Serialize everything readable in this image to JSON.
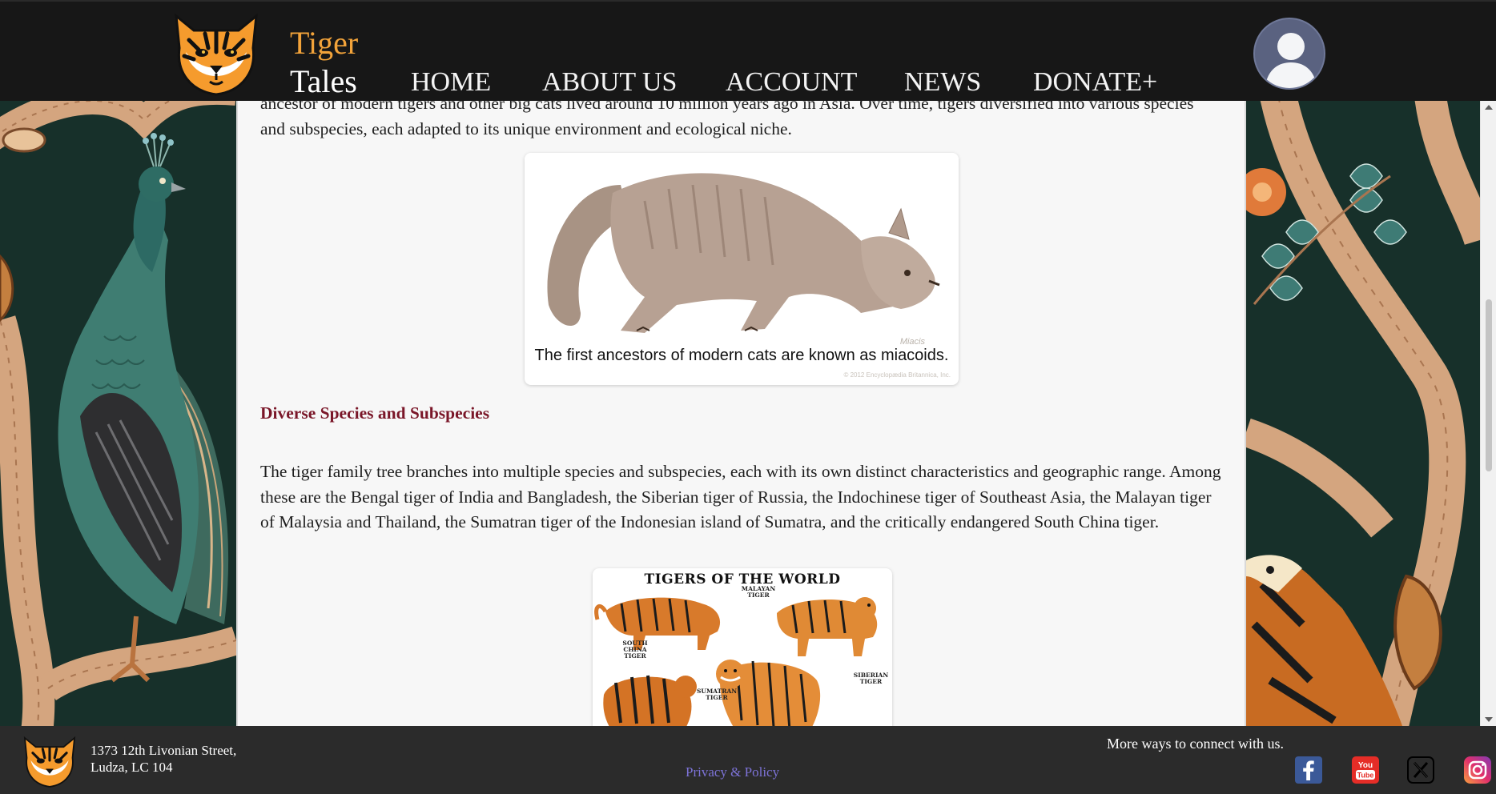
{
  "header": {
    "brand_top": "Tiger",
    "brand_bottom": "Tales",
    "nav": [
      "HOME",
      "ABOUT US",
      "ACCOUNT",
      "NEWS",
      "DONATE+"
    ]
  },
  "article": {
    "intro_tail": "ancestor of modern tigers and other big cats lived around 10 million years ago in Asia. Over time, tigers diversified into various species and subspecies, each adapted to its unique environment and ecological niche.",
    "figure1": {
      "caption": "The first ancestors of modern cats are known as miacoids.",
      "label": "Miacis",
      "copyright": "© 2012 Encyclopædia Britannica, Inc."
    },
    "section_heading": "Diverse Species and Subspecies",
    "species_paragraph": "The tiger family tree branches into multiple species and subspecies, each with its own distinct characteristics and geographic range. Among these are the Bengal tiger of India and Bangladesh, the Siberian tiger of Russia, the Indochinese tiger of Southeast Asia, the Malayan tiger of Malaysia and Thailand, the Sumatran tiger of the Indonesian island of Sumatra, and the critically endangered South China tiger.",
    "figure2": {
      "title": "TIGERS OF THE WORLD",
      "labels": {
        "malayan": "MALAYAN TIGER",
        "south_china": "SOUTH CHINA TIGER",
        "siberian": "SIBERIAN TIGER",
        "sumatran": "SUMATRAN TIGER"
      }
    }
  },
  "footer": {
    "address": "1373 12th Livonian Street, Ludza, LC 104",
    "privacy": "Privacy & Policy",
    "connect": "More ways to connect with us.",
    "social": [
      "facebook",
      "youtube",
      "x",
      "instagram"
    ]
  },
  "colors": {
    "header_bg": "#171717",
    "brand_orange": "#f2a33a",
    "heading_red": "#7a1628",
    "footer_bg": "#2b2b2b",
    "privacy_link": "#7d73d8",
    "jungle_bg": "#17302a"
  }
}
